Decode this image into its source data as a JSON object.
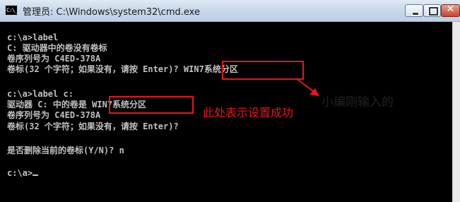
{
  "window": {
    "title": "管理员: C:\\Windows\\system32\\cmd.exe",
    "icon_label": "C:\\_",
    "icon": "cmd-icon",
    "controls": {
      "minimize": "minimize-icon",
      "maximize": "maximize-icon",
      "close": "✕"
    }
  },
  "console": {
    "lines": [
      "c:\\a>label",
      "C: 驱动器中的卷没有卷标",
      "卷序列号为 C4ED-378A",
      "卷标(32 个字符；如果没有，请按 Enter)? WIN7系统分区",
      "",
      "c:\\a>label c:",
      "驱动器 C: 中的卷是 WIN7系统分区",
      "卷序列号为 C4ED-378A",
      "卷标(32 个字符；如果没有，请按 Enter)?",
      "",
      "是否删除当前的卷标(Y/N)? n",
      "",
      "c:\\a>"
    ],
    "colors": {
      "background": "#000000",
      "text": "#c0c0c0"
    }
  },
  "annotations": {
    "typed_note": "小编刚输入的",
    "success_note": "此处表示设置成功",
    "highlight_color": "#e5161e"
  }
}
